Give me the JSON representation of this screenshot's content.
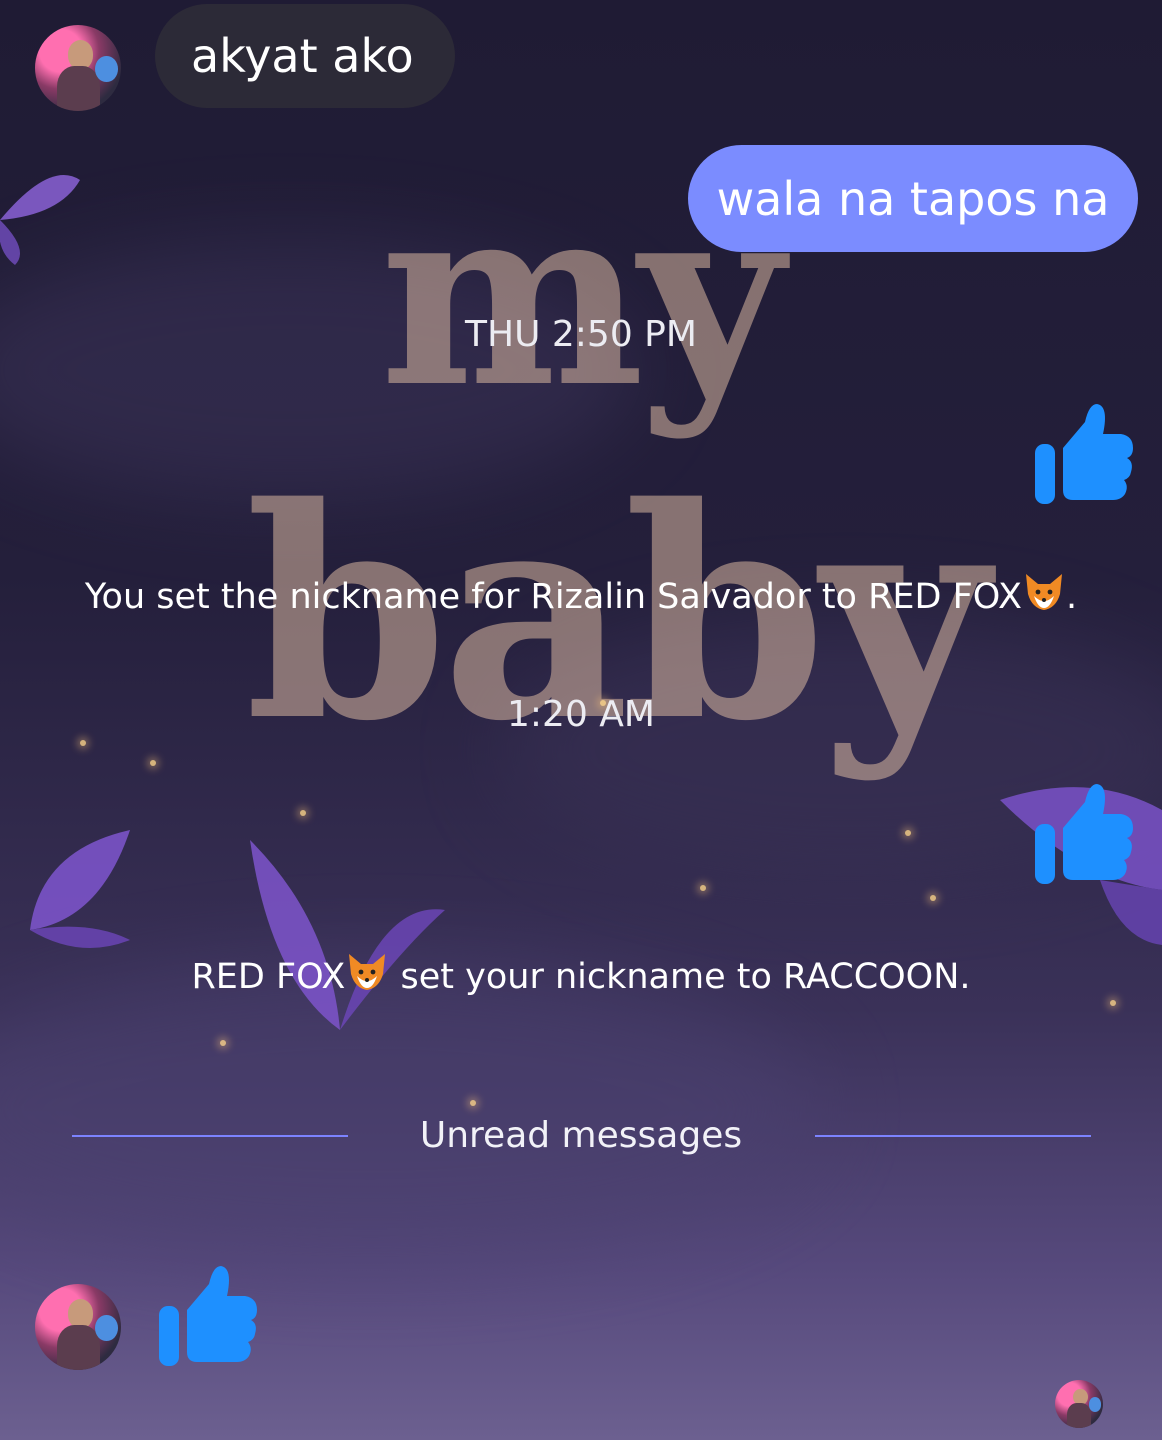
{
  "theme": {
    "outgoing_bubble_color": "#7b8cff",
    "incoming_bubble_color": "#2c2a37",
    "like_color": "#1e90ff",
    "unread_line_color": "#7c83ff"
  },
  "wallpaper": {
    "line1": "my",
    "line2": "baby"
  },
  "messages": {
    "incoming_1": {
      "text": "akyat ako"
    },
    "outgoing_1": {
      "text": "wala na tapos na"
    },
    "timestamp_1": "THU 2:50 PM",
    "system_1": {
      "text_before": "You set the nickname for Rizalin Salvador to RED FOX",
      "emoji": "fox-face",
      "text_after": "."
    },
    "timestamp_2": "1:20 AM",
    "system_2": {
      "text_before": "RED FOX",
      "emoji": "fox-face",
      "text_after": " set your nickname to RACCOON."
    }
  },
  "unread": {
    "label": "Unread messages"
  },
  "icons": {
    "like": "thumbs-up-icon",
    "avatar": "contact-avatar",
    "read_receipt": "read-receipt-avatar"
  }
}
